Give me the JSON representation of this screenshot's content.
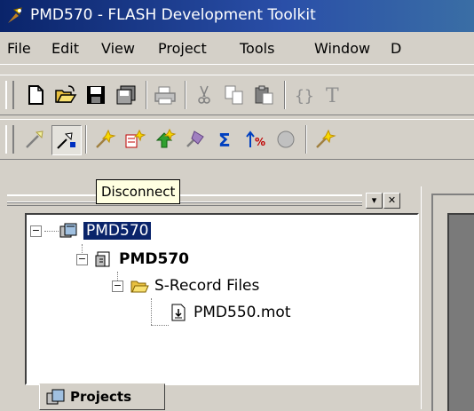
{
  "window": {
    "title": "PMD570 - FLASH Development Toolkit"
  },
  "menu": [
    "File",
    "Edit",
    "View",
    "Project",
    "Tools",
    "Window",
    "D"
  ],
  "toolbar1": [
    "new-file-icon",
    "open-folder-icon",
    "save-icon",
    "save-all-icon",
    "print-icon",
    "cut-icon",
    "copy-icon",
    "paste-icon",
    "braces-icon",
    "text-icon"
  ],
  "toolbar2": [
    "connect-icon",
    "disconnect-icon",
    "erase-icon",
    "blank-check-icon",
    "program-icon",
    "read-icon",
    "checksum-icon",
    "compare-icon",
    "stop-icon",
    "wand-icon"
  ],
  "tooltip": "Disconnect",
  "workspace": {
    "tree": {
      "root": "PMD570",
      "project": "PMD570",
      "folder": "S-Record Files",
      "file": "PMD550.mot"
    },
    "tab_label": "Projects"
  },
  "colors": {
    "titlebar": "#0a246a",
    "selection": "#0a246a",
    "tooltip_bg": "#ffffe1",
    "face": "#d4d0c8"
  }
}
